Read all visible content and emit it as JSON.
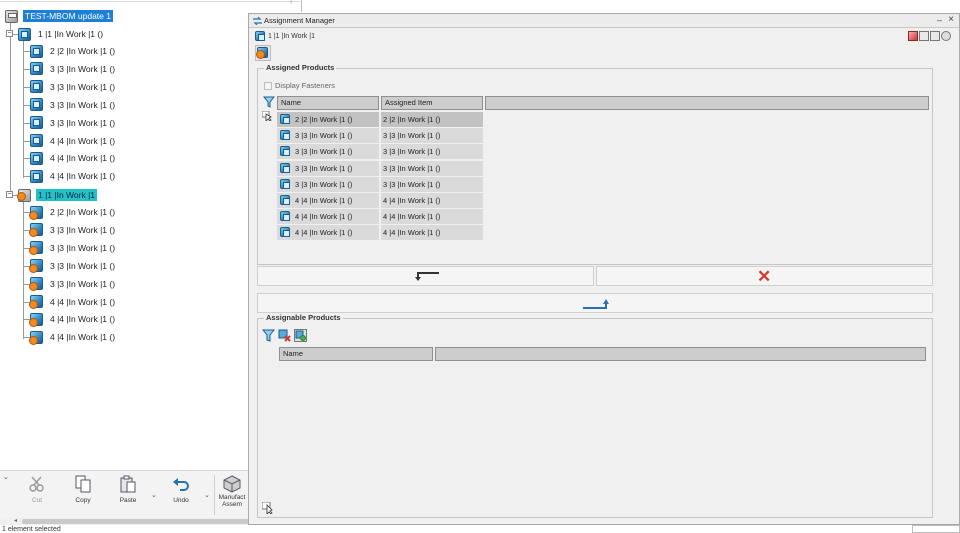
{
  "tree": {
    "nodes": [
      {
        "label": "TEST-MBOM update 1",
        "icon": "stack-icon",
        "highlight": "blue"
      },
      {
        "label": "1 |1 |In Work |1 ()",
        "icon": "cube-icon"
      },
      {
        "label": "2 |2 |In Work |1 ()",
        "icon": "cube-icon"
      },
      {
        "label": "3 |3 |In Work |1 ()",
        "icon": "cube-icon"
      },
      {
        "label": "3 |3 |In Work |1 ()",
        "icon": "cube-icon"
      },
      {
        "label": "3 |3 |In Work |1 ()",
        "icon": "cube-icon"
      },
      {
        "label": "3 |3 |In Work |1 ()",
        "icon": "cube-icon"
      },
      {
        "label": "4 |4 |In Work |1 ()",
        "icon": "cube-icon"
      },
      {
        "label": "4 |4 |In Work |1 ()",
        "icon": "cube-icon"
      },
      {
        "label": "4 |4 |In Work |1 ()",
        "icon": "cube-icon"
      },
      {
        "label": "1 |1 |In Work |1",
        "icon": "assembly-orange-icon",
        "highlight": "cyan"
      },
      {
        "label": "2 |2 |In Work |1 ()",
        "icon": "part-orange-icon"
      },
      {
        "label": "3 |3 |In Work |1 ()",
        "icon": "part-orange-icon"
      },
      {
        "label": "3 |3 |In Work |1 ()",
        "icon": "part-orange-icon"
      },
      {
        "label": "3 |3 |In Work |1 ()",
        "icon": "part-orange-icon"
      },
      {
        "label": "3 |3 |In Work |1 ()",
        "icon": "part-orange-icon"
      },
      {
        "label": "4 |4 |In Work |1 ()",
        "icon": "part-orange-icon"
      },
      {
        "label": "4 |4 |In Work |1 ()",
        "icon": "part-orange-icon"
      },
      {
        "label": "4 |4 |In Work |1 ()",
        "icon": "part-orange-icon"
      }
    ]
  },
  "toolbar": {
    "cut": "Cut",
    "copy": "Copy",
    "paste": "Paste",
    "undo": "Undo",
    "manufact_line1": "Manufact",
    "manufact_line2": "Assem"
  },
  "status": {
    "text": "1 element selected"
  },
  "assignment_manager": {
    "title": "Assignment Manager",
    "context": "1 |1 |In Work |1",
    "assigned": {
      "group_title": "Assigned Products",
      "display_fasteners": "Display Fasteners",
      "columns": [
        "Name",
        "Assigned Item"
      ],
      "rows": [
        {
          "name": "2 |2 |In Work |1 ()",
          "item": "2 |2 |In Work |1 ()"
        },
        {
          "name": "3 |3 |In Work |1 ()",
          "item": "3 |3 |In Work |1 ()"
        },
        {
          "name": "3 |3 |In Work |1 ()",
          "item": "3 |3 |In Work |1 ()"
        },
        {
          "name": "3 |3 |In Work |1 ()",
          "item": "3 |3 |In Work |1 ()"
        },
        {
          "name": "3 |3 |In Work |1 ()",
          "item": "3 |3 |In Work |1 ()"
        },
        {
          "name": "4 |4 |In Work |1 ()",
          "item": "4 |4 |In Work |1 ()"
        },
        {
          "name": "4 |4 |In Work |1 ()",
          "item": "4 |4 |In Work |1 ()"
        },
        {
          "name": "4 |4 |In Work |1 ()",
          "item": "4 |4 |In Work |1 ()"
        }
      ]
    },
    "assignable": {
      "group_title": "Assignable Products",
      "columns": [
        "Name"
      ]
    }
  },
  "colors": {
    "tree_highlight_blue": "#1e7fd6",
    "tree_highlight_cyan": "#20c4c8",
    "remove_red": "#d13b2f",
    "add_blue": "#2a6fb0"
  }
}
